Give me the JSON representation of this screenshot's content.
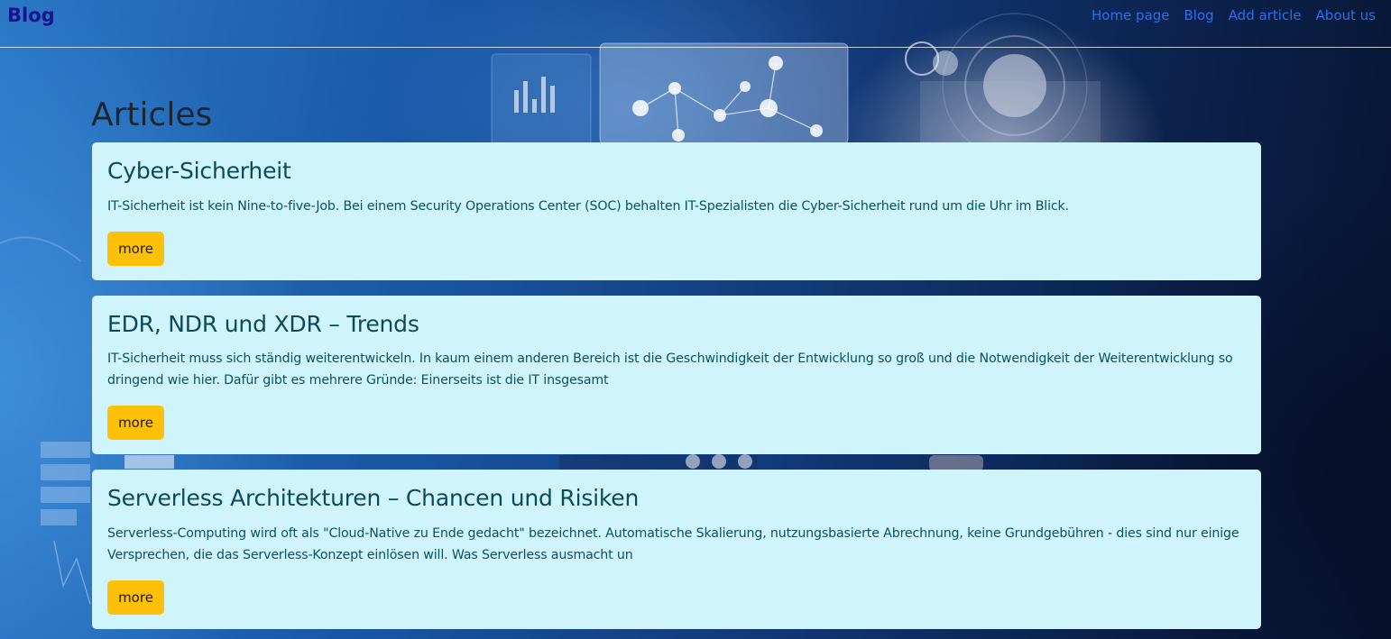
{
  "brand": "Blog",
  "nav": {
    "items": [
      {
        "label": "Home page"
      },
      {
        "label": "Blog"
      },
      {
        "label": "Add article"
      },
      {
        "label": "About us"
      }
    ]
  },
  "page": {
    "title": "Articles"
  },
  "articles": [
    {
      "title": "Cyber-Sicherheit",
      "excerpt": "IT-Sicherheit ist kein Nine-to-five-Job. Bei einem Security Operations Center (SOC) behalten IT-Spezialisten die Cyber-Sicherheit rund um die Uhr im Blick.",
      "button": "more"
    },
    {
      "title": "EDR, NDR und XDR – Trends",
      "excerpt": "IT-Sicherheit muss sich ständig weiterentwickeln. In kaum einem anderen Bereich ist die Geschwindigkeit der Entwicklung so groß und die Notwendigkeit der Weiterentwicklung so dringend wie hier. Dafür gibt es mehrere Gründe: Einerseits ist die IT insgesamt",
      "button": "more"
    },
    {
      "title": "Serverless Architekturen – Chancen und Risiken",
      "excerpt": "Serverless-Computing wird oft als \"Cloud-Native zu Ende gedacht\" bezeichnet. Automatische Skalierung, nutzungsbasierte Abrechnung, keine Grundgebühren - dies sind nur einige Versprechen, die das Serverless-Konzept einlösen will. Was Serverless ausmacht un",
      "button": "more"
    }
  ],
  "colors": {
    "brand": "#14148c",
    "nav_link": "#2a6ff0",
    "card_bg": "#cff4fc",
    "card_text": "#0c4a5a",
    "button_bg": "#ffc107"
  }
}
